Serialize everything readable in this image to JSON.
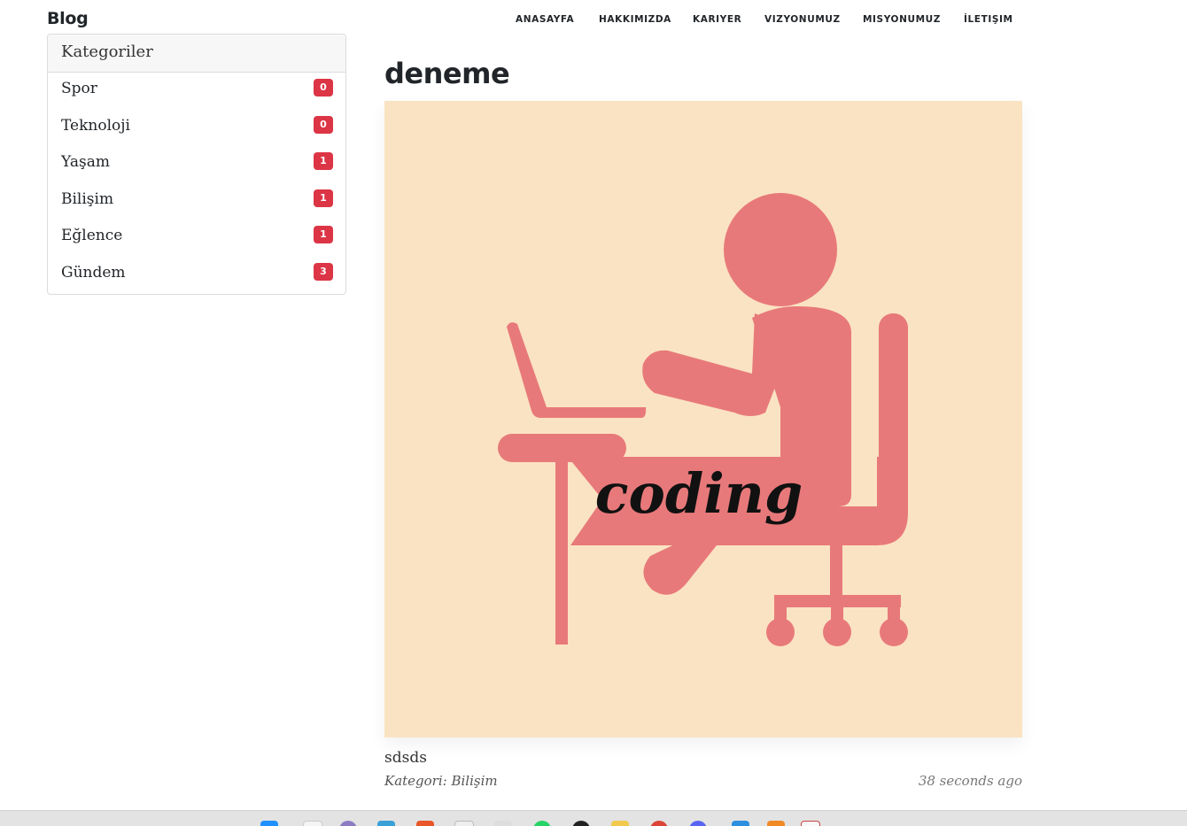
{
  "navbar": {
    "brand": "Blog",
    "links": [
      "ANASAYFA",
      "HAKKIMIZDA",
      "KARIYER",
      "VIZYONUMUZ",
      "MISYONUMUZ",
      "İLETIŞIM"
    ]
  },
  "sidebar": {
    "header": "Kategoriler",
    "items": [
      {
        "label": "Spor",
        "count": "0"
      },
      {
        "label": "Teknoloji",
        "count": "0"
      },
      {
        "label": "Yaşam",
        "count": "1"
      },
      {
        "label": "Bilişim",
        "count": "1"
      },
      {
        "label": "Eğlence",
        "count": "1"
      },
      {
        "label": "Gündem",
        "count": "3"
      }
    ],
    "badge_color": "#dc3545"
  },
  "post": {
    "title": "deneme",
    "image_text": "coding",
    "body": "sdsds",
    "category": "Kategori: Bilişim",
    "time": "38 seconds ago",
    "image_bg": "#fae3c2",
    "figure_color": "#e8797a"
  },
  "taskbar": {
    "icons": [
      "windows-start-icon",
      "file-icon",
      "app-circle-icon",
      "store-icon",
      "office-icon",
      "mail-icon",
      "notepad-icon",
      "whatsapp-icon",
      "github-icon",
      "folder-icon",
      "chrome-icon",
      "discord-icon",
      "vscode-icon",
      "sublime-icon",
      "calendar-icon"
    ]
  }
}
